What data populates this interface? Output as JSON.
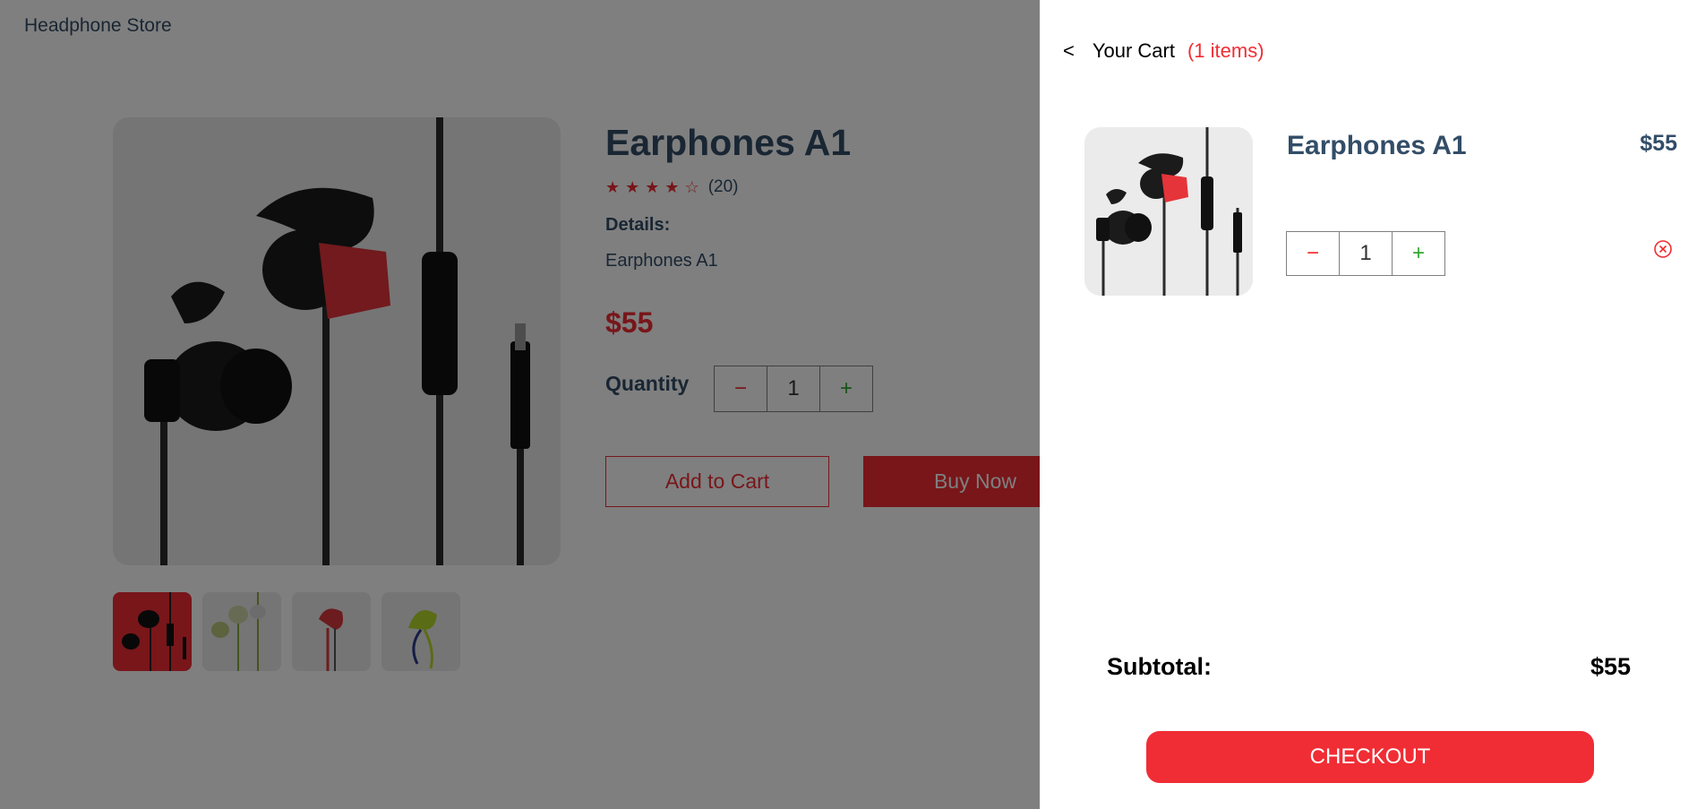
{
  "store": {
    "logo": "Headphone Store"
  },
  "product": {
    "name": "Earphones A1",
    "rating": {
      "stars": 4,
      "max": 5,
      "count": "(20)"
    },
    "details_label": "Details:",
    "details": "Earphones A1",
    "price": "$55",
    "quantity_label": "Quantity",
    "quantity": "1",
    "add_to_cart": "Add to Cart",
    "buy_now": "Buy Now",
    "thumbnails": [
      "black-red",
      "white-green",
      "red",
      "yellow-green"
    ]
  },
  "cart": {
    "back_icon": "chevron-left-icon",
    "title": "Your Cart",
    "count": "(1 items)",
    "items": [
      {
        "name": "Earphones A1",
        "price": "$55",
        "quantity": "1"
      }
    ],
    "subtotal_label": "Subtotal:",
    "subtotal_value": "$55",
    "checkout": "CHECKOUT"
  },
  "symbols": {
    "minus": "−",
    "plus": "+",
    "back": "<"
  },
  "colors": {
    "accent": "#f02d34",
    "heading": "#324d67",
    "plus": "#31a831"
  }
}
